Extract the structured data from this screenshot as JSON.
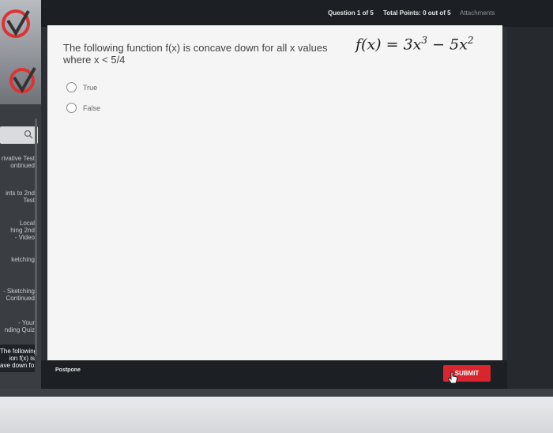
{
  "topbar": {
    "question": "Question 1 of 5",
    "points": "Total Points: 0 out of 5",
    "attachments": "Attachments"
  },
  "sidebar": {
    "items": [
      {
        "label": "rivative Test\nontinued"
      },
      {
        "label": "ints to 2nd\nTest"
      },
      {
        "label": "Local\nhing 2nd\n- Video"
      },
      {
        "label": "ketching"
      },
      {
        "label": "- Sketching\nContinued"
      },
      {
        "label": "- Your\nnding Quiz"
      },
      {
        "label": "The following\nion f(x) is\nave down fo..."
      }
    ]
  },
  "question": {
    "text": "The following function f(x) is concave down for all x values where x < 5/4",
    "formula_lhs": "f(x) = 3x",
    "formula_exp1": "3",
    "formula_mid": " − 5x",
    "formula_exp2": "2"
  },
  "choices": [
    {
      "label": "True"
    },
    {
      "label": "False"
    }
  ],
  "footer": {
    "postpone": "Postpone",
    "submit": "SUBMIT"
  }
}
